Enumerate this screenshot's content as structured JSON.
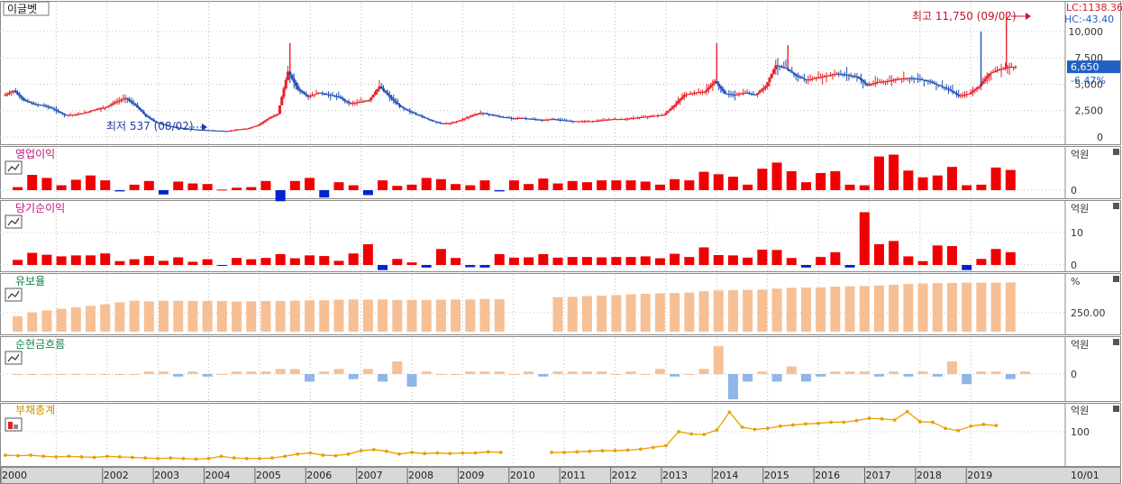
{
  "chart_data": [
    {
      "type": "candlestick",
      "title": "이글벳",
      "lc_label": "LC:1138.36",
      "hc_label": "HC:-43.40",
      "current_value": "6,650",
      "current_change": "-6.47%",
      "high_note": "최고 11,750 (09/02)",
      "low_note": "최저 537 (08/02)",
      "y_ticks": [
        "10,000",
        "7,500",
        "5,000",
        "2,500",
        "0"
      ],
      "ylim": [
        0,
        12300
      ],
      "high": {
        "date": "2019.7",
        "value": 11750
      },
      "low": {
        "date": "2004.4",
        "value": 537
      },
      "closes": [
        [
          2000.0,
          3900
        ],
        [
          2000.2,
          4400
        ],
        [
          2000.4,
          3500
        ],
        [
          2000.6,
          3100
        ],
        [
          2000.8,
          3000
        ],
        [
          2001.0,
          2600
        ],
        [
          2001.2,
          2100
        ],
        [
          2001.4,
          2100
        ],
        [
          2001.6,
          2300
        ],
        [
          2001.8,
          2600
        ],
        [
          2002.0,
          2800
        ],
        [
          2002.2,
          3300
        ],
        [
          2002.4,
          3700
        ],
        [
          2002.6,
          3000
        ],
        [
          2002.8,
          2000
        ],
        [
          2003.0,
          1400
        ],
        [
          2003.2,
          1100
        ],
        [
          2003.4,
          900
        ],
        [
          2003.6,
          800
        ],
        [
          2003.8,
          700
        ],
        [
          2004.0,
          650
        ],
        [
          2004.2,
          600
        ],
        [
          2004.4,
          560
        ],
        [
          2004.6,
          700
        ],
        [
          2004.8,
          800
        ],
        [
          2005.0,
          1100
        ],
        [
          2005.2,
          1700
        ],
        [
          2005.4,
          2200
        ],
        [
          2005.6,
          6200
        ],
        [
          2005.8,
          4500
        ],
        [
          2006.0,
          3800
        ],
        [
          2006.2,
          4200
        ],
        [
          2006.4,
          4000
        ],
        [
          2006.6,
          3800
        ],
        [
          2006.8,
          3200
        ],
        [
          2007.0,
          3300
        ],
        [
          2007.2,
          3500
        ],
        [
          2007.4,
          4800
        ],
        [
          2007.6,
          3800
        ],
        [
          2007.8,
          2900
        ],
        [
          2008.0,
          2400
        ],
        [
          2008.2,
          2000
        ],
        [
          2008.4,
          1600
        ],
        [
          2008.6,
          1300
        ],
        [
          2008.8,
          1300
        ],
        [
          2009.0,
          1600
        ],
        [
          2009.2,
          2000
        ],
        [
          2009.4,
          2300
        ],
        [
          2009.6,
          2100
        ],
        [
          2009.8,
          1900
        ],
        [
          2010.0,
          1800
        ],
        [
          2010.2,
          1800
        ],
        [
          2010.4,
          1700
        ],
        [
          2010.6,
          1600
        ],
        [
          2010.8,
          1700
        ],
        [
          2011.0,
          1600
        ],
        [
          2011.2,
          1500
        ],
        [
          2011.4,
          1500
        ],
        [
          2011.6,
          1500
        ],
        [
          2011.8,
          1600
        ],
        [
          2012.0,
          1700
        ],
        [
          2012.2,
          1700
        ],
        [
          2012.4,
          1800
        ],
        [
          2012.6,
          1900
        ],
        [
          2012.8,
          2000
        ],
        [
          2013.0,
          2100
        ],
        [
          2013.2,
          3000
        ],
        [
          2013.4,
          4000
        ],
        [
          2013.6,
          4200
        ],
        [
          2013.8,
          4300
        ],
        [
          2014.0,
          5300
        ],
        [
          2014.2,
          4100
        ],
        [
          2014.4,
          4000
        ],
        [
          2014.6,
          4200
        ],
        [
          2014.8,
          4000
        ],
        [
          2015.0,
          4800
        ],
        [
          2015.2,
          6800
        ],
        [
          2015.4,
          6500
        ],
        [
          2015.6,
          5800
        ],
        [
          2015.8,
          5400
        ],
        [
          2016.0,
          5600
        ],
        [
          2016.2,
          5800
        ],
        [
          2016.4,
          6000
        ],
        [
          2016.6,
          5900
        ],
        [
          2016.8,
          5700
        ],
        [
          2017.0,
          4900
        ],
        [
          2017.2,
          5200
        ],
        [
          2017.4,
          5300
        ],
        [
          2017.6,
          5500
        ],
        [
          2017.8,
          5600
        ],
        [
          2018.0,
          5500
        ],
        [
          2018.2,
          5300
        ],
        [
          2018.4,
          4900
        ],
        [
          2018.6,
          4500
        ],
        [
          2018.8,
          3900
        ],
        [
          2019.0,
          4100
        ],
        [
          2019.2,
          4800
        ],
        [
          2019.4,
          6000
        ],
        [
          2019.6,
          6400
        ],
        [
          2019.8,
          6650
        ]
      ]
    },
    {
      "type": "bar",
      "title": "영업이익",
      "unit": "억원",
      "y_ticks": [
        "0"
      ],
      "values": [
        0.5,
        2.5,
        2,
        0.8,
        1.7,
        2.4,
        1.6,
        -0.2,
        0.9,
        1.5,
        -0.7,
        1.4,
        1.1,
        1,
        0.1,
        0.4,
        0.5,
        1.5,
        -1.8,
        1.5,
        2,
        -1.2,
        1.3,
        0.8,
        -0.8,
        1.6,
        0.7,
        0.9,
        2,
        1.8,
        1,
        0.8,
        1.6,
        -0.2,
        1.6,
        1,
        1.9,
        1.1,
        1.5,
        1.3,
        1.6,
        1.6,
        1.6,
        1.4,
        0.9,
        1.8,
        1.6,
        3,
        2.6,
        2.2,
        0.9,
        3.5,
        4.5,
        3.1,
        1.3,
        2.8,
        3.1,
        0.9,
        0.8,
        5.5,
        5.8,
        3.2,
        2.1,
        2.4,
        3.8,
        0.8,
        0.9,
        3.7,
        3.3
      ]
    },
    {
      "type": "bar",
      "title": "당기순이익",
      "unit": "억원",
      "y_ticks": [
        "10",
        "0"
      ],
      "values": [
        1.6,
        3.8,
        3.2,
        2.7,
        3,
        3,
        3.6,
        1.2,
        1.8,
        2.8,
        1.3,
        2.4,
        1,
        1.8,
        -0.3,
        2.2,
        1.8,
        2.2,
        3.4,
        2.1,
        3,
        2.8,
        1.3,
        3.6,
        6.5,
        -1.6,
        1.9,
        0.8,
        -0.8,
        5,
        2.2,
        -0.7,
        -0.8,
        3.4,
        2.3,
        2.4,
        3.4,
        2.3,
        2.5,
        2.5,
        2.4,
        2.5,
        2.5,
        2.7,
        2.1,
        3.5,
        2.5,
        5.5,
        3.1,
        3,
        2.3,
        4.8,
        4.7,
        2.2,
        -0.8,
        2.5,
        4,
        -0.8,
        16.5,
        6.5,
        7.5,
        2.7,
        1.2,
        6.1,
        5.9,
        -1.6,
        1.9,
        5,
        4
      ]
    },
    {
      "type": "bar",
      "title": "유보율",
      "unit": "%",
      "y_ticks": [
        "250.00"
      ],
      "values": [
        120,
        150,
        165,
        178,
        190,
        200,
        212,
        228,
        240,
        235,
        240,
        240,
        238,
        238,
        238,
        234,
        236,
        238,
        238,
        240,
        243,
        244,
        248,
        250,
        248,
        250,
        246,
        246,
        246,
        248,
        250,
        250,
        254,
        252,
        null,
        null,
        null,
        268,
        270,
        276,
        280,
        284,
        290,
        294,
        298,
        300,
        304,
        314,
        320,
        322,
        324,
        326,
        334,
        340,
        342,
        344,
        350,
        352,
        354,
        358,
        365,
        370,
        374,
        376,
        378,
        380,
        380,
        380,
        382
      ]
    },
    {
      "type": "bar",
      "title": "순현금흐름",
      "unit": "억원",
      "y_ticks": [
        "0"
      ],
      "values": [
        0,
        0,
        0,
        0,
        0,
        0,
        0,
        0,
        0,
        1,
        1,
        -1,
        1,
        -1,
        0,
        1,
        1,
        1,
        2,
        2,
        -3,
        1,
        2,
        -2,
        2,
        -3,
        5,
        -5,
        1,
        0,
        0,
        1,
        1,
        1,
        0,
        1,
        -1,
        1,
        1,
        1,
        1,
        0,
        1,
        0,
        2,
        -1,
        0,
        2,
        11,
        -10,
        -3,
        1,
        -3,
        3,
        -3,
        -1,
        1,
        1,
        1,
        -1,
        1,
        -1,
        1,
        -1,
        5,
        -4,
        1,
        1,
        -2,
        1
      ]
    },
    {
      "type": "line",
      "title": "부채총계",
      "unit": "억원",
      "y_ticks": [
        "100"
      ],
      "x": [
        2000.0,
        2000.25,
        2000.5,
        2000.75,
        2001.0,
        2001.25,
        2001.5,
        2001.75,
        2002.0,
        2002.25,
        2002.5,
        2002.75,
        2003.0,
        2003.25,
        2003.5,
        2003.75,
        2004.0,
        2004.25,
        2004.5,
        2004.75,
        2005.0,
        2005.25,
        2005.5,
        2005.75,
        2006.0,
        2006.25,
        2006.5,
        2006.75,
        2007.0,
        2007.25,
        2007.5,
        2007.75,
        2008.0,
        2008.25,
        2008.5,
        2008.75,
        2009.0,
        2009.25,
        2009.5,
        2009.75,
        null,
        2010.75,
        2011.0,
        2011.25,
        2011.5,
        2011.75,
        2012.0,
        2012.25,
        2012.5,
        2012.75,
        2013.0,
        2013.25,
        2013.5,
        2013.75,
        2014.0,
        2014.25,
        2014.5,
        2014.75,
        2015.0,
        2015.25,
        2015.5,
        2015.75,
        2016.0,
        2016.25,
        2016.5,
        2016.75,
        2017.0,
        2017.25,
        2017.5,
        2017.75,
        2018.0,
        2018.25,
        2018.5,
        2018.75,
        2019.0,
        2019.25,
        2019.5
      ],
      "values": [
        58,
        57,
        58,
        56,
        55,
        56,
        55,
        54,
        56,
        55,
        54,
        53,
        52,
        53,
        52,
        51,
        52,
        56,
        53,
        52,
        52,
        53,
        56,
        60,
        62,
        58,
        57,
        60,
        66,
        68,
        65,
        60,
        63,
        61,
        62,
        61,
        62,
        62,
        64,
        63,
        null,
        63,
        63,
        64,
        65,
        66,
        66,
        67,
        69,
        72,
        75,
        100,
        96,
        95,
        103,
        135,
        108,
        104,
        106,
        110,
        112,
        114,
        115,
        117,
        117,
        120,
        124,
        123,
        121,
        136,
        118,
        117,
        106,
        102,
        110,
        113,
        111
      ]
    }
  ],
  "x_axis": {
    "labels": [
      "2000",
      "2002",
      "2003",
      "2004",
      "2005",
      "2006",
      "2007",
      "2008",
      "2009",
      "2010",
      "2011",
      "2012",
      "2013",
      "2014",
      "2015",
      "2016",
      "2017",
      "2018",
      "2019"
    ],
    "right_label": "10/01"
  }
}
